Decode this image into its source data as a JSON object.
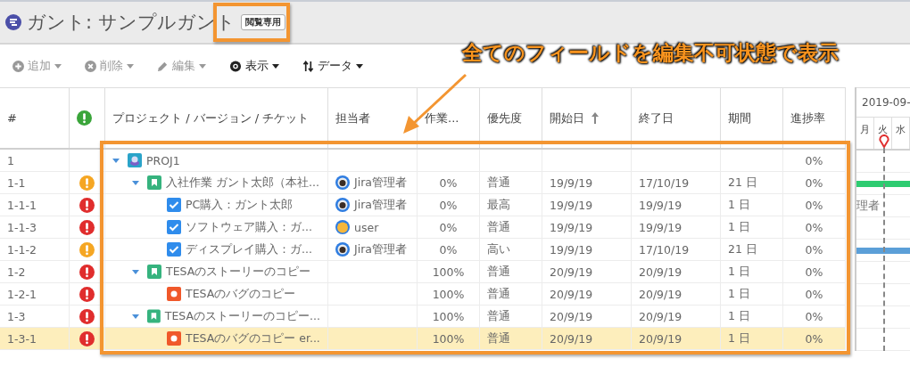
{
  "header": {
    "title": "ガント: サンプルガント",
    "badge": "閲覧専用"
  },
  "toolbar": [
    {
      "kind": "add",
      "label": "追加",
      "disabled": true
    },
    {
      "kind": "delete",
      "label": "削除",
      "disabled": true
    },
    {
      "kind": "edit",
      "label": "編集",
      "disabled": true
    },
    {
      "kind": "view",
      "label": "表示",
      "disabled": false
    },
    {
      "kind": "data",
      "label": "データ",
      "disabled": false
    }
  ],
  "columns": [
    {
      "kind": "text",
      "label": "#",
      "sorted": false
    },
    {
      "kind": "alert",
      "sorted": false
    },
    {
      "kind": "text",
      "label": "プロジェクト / バージョン / チケット",
      "sorted": false
    },
    {
      "kind": "text",
      "label": "担当者",
      "sorted": false
    },
    {
      "kind": "text",
      "label": "作業...",
      "sorted": false
    },
    {
      "kind": "text",
      "label": "優先度",
      "sorted": false
    },
    {
      "kind": "text",
      "label": "開始日",
      "sorted": true
    },
    {
      "kind": "text",
      "label": "終了日",
      "sorted": false
    },
    {
      "kind": "text",
      "label": "期間",
      "sorted": false
    },
    {
      "kind": "text",
      "label": "進捗率",
      "sorted": false
    }
  ],
  "rows": [
    {
      "number": "1",
      "kind": "project",
      "name": "PROJ1",
      "expanded": true,
      "progress": "0%",
      "selected": false,
      "children": [
        {
          "number": "1-1",
          "color": "#f5a623",
          "kind": "story",
          "name": "入社作業 ガント太郎（本社...",
          "expanded": true,
          "avatar": {
            "kind": "admin"
          },
          "assignee": "Jira管理者",
          "work": "0%",
          "priority": "普通",
          "start": "19/9/19",
          "end": "17/10/19",
          "duration": "21 日",
          "progress": "0%",
          "selected": false,
          "bar": {
            "color": "#2ecc71"
          },
          "children": [
            {
              "number": "1-1-1",
              "color": "#e02d2d",
              "kind": "task",
              "name": "PC購入：ガント太郎",
              "avatar": {
                "kind": "admin"
              },
              "assignee": "Jira管理者",
              "work": "0%",
              "priority": "最高",
              "start": "19/9/19",
              "end": "19/9/19",
              "duration": "1 日",
              "progress": "0%",
              "selected": false,
              "gantt_label": "理者"
            },
            {
              "number": "1-1-3",
              "color": "#e02d2d",
              "kind": "task",
              "name": "ソフトウェア購入：ガ...",
              "avatar": {
                "kind": "user"
              },
              "assignee": "user",
              "work": "0%",
              "priority": "普通",
              "start": "19/9/19",
              "end": "19/9/19",
              "duration": "1 日",
              "progress": "0%",
              "selected": false
            },
            {
              "number": "1-1-2",
              "color": "#f5a623",
              "kind": "task",
              "name": "ディスプレイ購入：ガ...",
              "avatar": {
                "kind": "admin"
              },
              "assignee": "Jira管理者",
              "work": "0%",
              "priority": "高い",
              "start": "19/9/19",
              "end": "17/10/19",
              "duration": "21 日",
              "progress": "0%",
              "selected": false,
              "bar": {
                "color": "#5b9fd8"
              }
            }
          ]
        },
        {
          "number": "1-2",
          "color": "#e02d2d",
          "kind": "story",
          "name": "TESAのストーリーのコピー",
          "expanded": true,
          "work": "100%",
          "priority": "普通",
          "start": "20/9/19",
          "end": "20/9/19",
          "duration": "1 日",
          "progress": "0%",
          "selected": false,
          "children": [
            {
              "number": "1-2-1",
              "color": "#e02d2d",
              "kind": "bug",
              "name": "TESAのバグのコピー",
              "work": "100%",
              "priority": "普通",
              "start": "20/9/19",
              "end": "20/9/19",
              "duration": "1 日",
              "progress": "0%",
              "selected": false
            }
          ]
        },
        {
          "number": "1-3",
          "color": "#e02d2d",
          "kind": "story",
          "name": "TESAのストーリーのコピー...",
          "expanded": true,
          "work": "100%",
          "priority": "普通",
          "start": "20/9/19",
          "end": "20/9/19",
          "duration": "1 日",
          "progress": "0%",
          "selected": false,
          "children": [
            {
              "number": "1-3-1",
              "color": "#e02d2d",
              "kind": "bug",
              "name": "TESAのバグのコピー er...",
              "work": "100%",
              "priority": "普通",
              "start": "20/9/19",
              "end": "20/9/19",
              "duration": "1 日",
              "progress": "0%",
              "selected": true
            }
          ]
        }
      ]
    }
  ],
  "gantt": {
    "date": "2019-09-",
    "days": [
      {
        "label": "月",
        "today": false
      },
      {
        "label": "火",
        "today": true
      },
      {
        "label": "水",
        "today": false
      }
    ]
  },
  "annotation": {
    "text": "全てのフィールドを編集不可状態で表示"
  }
}
